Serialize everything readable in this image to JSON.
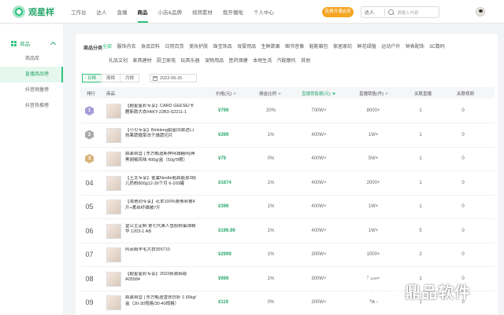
{
  "brand": {
    "name": "观星样",
    "accent": "#2ec27e"
  },
  "topnav": [
    "工作台",
    "达人",
    "直播",
    "商品",
    "小店&品牌",
    "视频素材",
    "我开播啦",
    "个人中心"
  ],
  "topnav_active": "商品",
  "promo_button": "免费开通会员",
  "search": {
    "type": "达人",
    "placeholder": "请输入内容"
  },
  "sidebar": {
    "group": "商品",
    "items": [
      {
        "label": "商品库",
        "active": false
      },
      {
        "label": "直播商品榜",
        "active": true
      },
      {
        "label": "抖音销量榜",
        "active": false
      },
      {
        "label": "抖音热推榜",
        "active": false
      }
    ]
  },
  "categories": {
    "label": "商品分类",
    "row1": [
      "全部",
      "服饰内衣",
      "食品饮料",
      "日用百货",
      "美妆护肤",
      "珠宝饰品",
      "母婴用品",
      "生鲜蔬果",
      "图书音像",
      "鞋靴箱包",
      "家居家纺",
      "鲜花绿植",
      "运动户外",
      "钟表配饰",
      "3C数码"
    ],
    "row2": [
      "礼品文创",
      "家具建材",
      "厨卫家电",
      "玩具乐器",
      "宠物用品",
      "医药保健",
      "本地生活",
      "汽配摩托",
      "其他"
    ],
    "active": "全部"
  },
  "period": {
    "tabs": [
      "日榜",
      "周榜",
      "月榜"
    ],
    "active": "日榜",
    "date": "2022-09-25"
  },
  "table": {
    "headers": {
      "rank": "排行",
      "product": "商品",
      "price": "价格(元)",
      "commission": "佣金比例",
      "live_sales": "直播销售额(元)",
      "live_volume": "直播销售(件)",
      "related_live": "关联直播",
      "related_video": "关联视频"
    },
    "rows": [
      {
        "rank": "1",
        "name": "【超星星彩专享】CARD GEESE/卡雁新款大衣#AKY-22B3-S2211-1",
        "price": "¥799",
        "commission": "20%",
        "sales": "700W+",
        "volume": "8000+",
        "live": "1",
        "video": "0"
      },
      {
        "rank": "2",
        "name": "【小贝专享】Binkleng鹤星同款进口热果蔬微菜冻干燥蔬切片",
        "price": "¥399",
        "commission": "1%",
        "sales": "400W+",
        "volume": "1W+",
        "live": "1",
        "video": "0"
      },
      {
        "rank": "3",
        "name": "瓶装自营 | 东方甄选斯林特减糖/经典黑胡椒风味 400g/盒（50g*8根）",
        "price": "¥79",
        "commission": "0%",
        "sales": "400W+",
        "volume": "5W+",
        "live": "1",
        "video": "0"
      },
      {
        "rank": "04",
        "name": "【王太专享】雀巢Nestle超启能恩3段儿奶粉800g12-36个月 6-100罐",
        "price": "¥1674",
        "commission": "1%",
        "sales": "400W+",
        "volume": "2000+",
        "live": "1",
        "video": "0"
      },
      {
        "rank": "05",
        "name": "【我爸同专享】花本100%桑蚕丝被4斤+柔丝纤维被7斤",
        "price": "¥399",
        "commission": "1%",
        "sales": "400W+",
        "volume": "1W+",
        "live": "1",
        "video": "0"
      },
      {
        "rank": "06",
        "name": "皇公主定制 第七代果人鱼胶粉蛋球精华 1203-1 AB",
        "price": "¥199.99",
        "commission": "1%",
        "sales": "400W+",
        "volume": "1W+",
        "live": "5",
        "video": "0"
      },
      {
        "rank": "07",
        "name": "阿菲姆羊毛大衣355710",
        "price": "¥2999",
        "commission": "1%",
        "sales": "300W+",
        "volume": "1000+",
        "live": "2",
        "video": "0"
      },
      {
        "rank": "08",
        "name": "【超星星彩专享】2022新款韩版A05584",
        "price": "¥999",
        "commission": "1%",
        "sales": "300W+",
        "volume": "3000+",
        "live": "1",
        "video": "0"
      },
      {
        "rank": "09",
        "name": "瓶装自营 | 东方甄选雪莲白虾 1.65kg/盒（20-30规格/30-40规格）",
        "price": "¥119",
        "commission": "0%",
        "sales": "300W+",
        "volume": "2W+",
        "live": "1",
        "video": "0"
      }
    ]
  },
  "badge_colors": [
    "#a59bd6",
    "#a9a9a9",
    "#d9b37a"
  ],
  "watermark": "鼎品软件"
}
